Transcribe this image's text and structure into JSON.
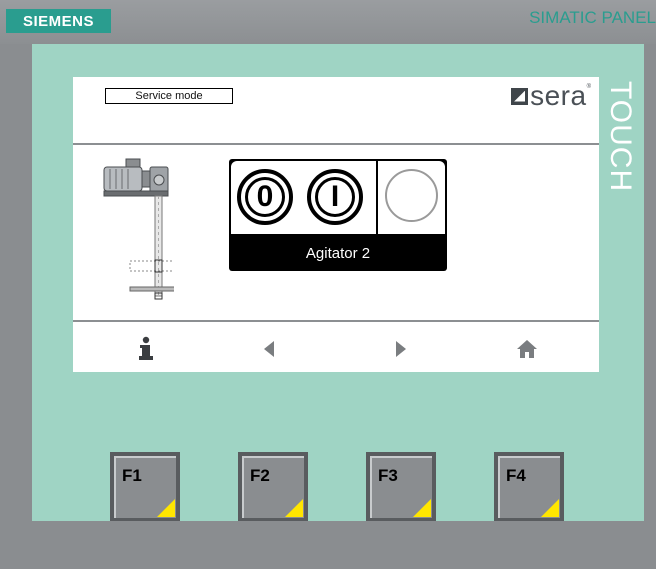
{
  "header": {
    "brand": "SIEMENS",
    "product": "SIMATIC PANEL",
    "touch": "TOUCH"
  },
  "screen": {
    "mode_label": "Service mode",
    "logo": {
      "text": "sera",
      "mark": "®"
    },
    "device": {
      "name": "Agitator 2",
      "off_button": "0",
      "on_button": "I",
      "status": "off"
    },
    "nav": [
      {
        "icon": "info-icon"
      },
      {
        "icon": "arrow-left-icon"
      },
      {
        "icon": "arrow-right-icon"
      },
      {
        "icon": "home-icon"
      }
    ]
  },
  "function_keys": [
    {
      "label": "F1"
    },
    {
      "label": "F2"
    },
    {
      "label": "F3"
    },
    {
      "label": "F4"
    }
  ],
  "colors": {
    "brand": "#2a9d8f",
    "frame": "#9fd4c4",
    "fkey_triangle": "#ffe600"
  }
}
